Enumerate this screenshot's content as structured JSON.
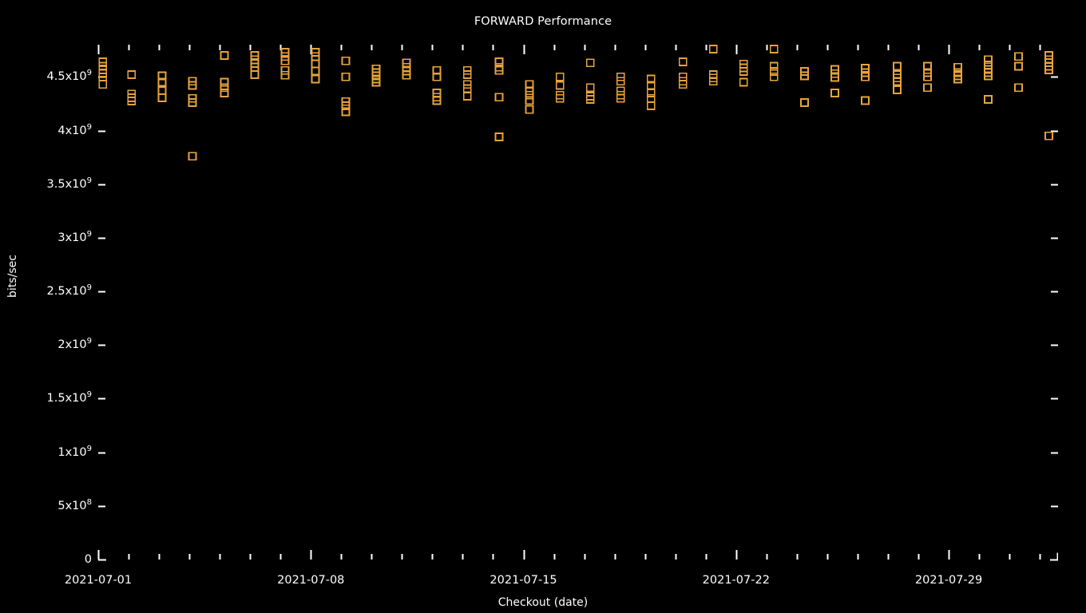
{
  "chart_data": {
    "type": "scatter",
    "title": "FORWARD Performance",
    "xlabel": "Checkout (date)",
    "ylabel": "bits/sec",
    "grid": false,
    "legend": null,
    "marker": "open-square",
    "marker_color": "#e8a33c",
    "background": "#000000",
    "foreground": "#ffffff",
    "ylim": [
      0,
      4800000000
    ],
    "ytick_labels": [
      {
        "text": "0",
        "sup": "",
        "value": 0
      },
      {
        "text": "5x10",
        "sup": "8",
        "value": 500000000
      },
      {
        "text": "1x10",
        "sup": "9",
        "value": 1000000000
      },
      {
        "text": "1.5x10",
        "sup": "9",
        "value": 1500000000
      },
      {
        "text": "2x10",
        "sup": "9",
        "value": 2000000000
      },
      {
        "text": "2.5x10",
        "sup": "9",
        "value": 2500000000
      },
      {
        "text": "3x10",
        "sup": "9",
        "value": 3000000000
      },
      {
        "text": "3.5x10",
        "sup": "9",
        "value": 3500000000
      },
      {
        "text": "4x10",
        "sup": "9",
        "value": 4000000000
      },
      {
        "text": "4.5x10",
        "sup": "9",
        "value": 4500000000
      }
    ],
    "xlim": [
      "2021-07-01",
      "2021-08-01"
    ],
    "xtick_labels": [
      {
        "text": "2021-07-01",
        "value": 0
      },
      {
        "text": "2021-07-08",
        "value": 7
      },
      {
        "text": "2021-07-15",
        "value": 14
      },
      {
        "text": "2021-07-22",
        "value": 21
      },
      {
        "text": "2021-07-29",
        "value": 28
      }
    ],
    "x_major_ticks": [
      0,
      7,
      14,
      21,
      28
    ],
    "x_minor_ticks": [
      1,
      2,
      3,
      4,
      5,
      6,
      8,
      9,
      10,
      11,
      12,
      13,
      15,
      16,
      17,
      18,
      19,
      20,
      22,
      23,
      24,
      25,
      26,
      27,
      29,
      30,
      31
    ],
    "series": [
      {
        "name": "FORWARD",
        "points": [
          {
            "x": 0.15,
            "y": 4640000000
          },
          {
            "x": 0.15,
            "y": 4600000000
          },
          {
            "x": 0.15,
            "y": 4565000000
          },
          {
            "x": 0.15,
            "y": 4535000000
          },
          {
            "x": 0.15,
            "y": 4500000000
          },
          {
            "x": 0.15,
            "y": 4430000000
          },
          {
            "x": 1.1,
            "y": 4520000000
          },
          {
            "x": 1.1,
            "y": 4340000000
          },
          {
            "x": 1.1,
            "y": 4305000000
          },
          {
            "x": 1.1,
            "y": 4275000000
          },
          {
            "x": 2.1,
            "y": 4510000000
          },
          {
            "x": 2.1,
            "y": 4450000000
          },
          {
            "x": 2.1,
            "y": 4370000000
          },
          {
            "x": 2.1,
            "y": 4305000000
          },
          {
            "x": 3.1,
            "y": 4460000000
          },
          {
            "x": 3.1,
            "y": 4420000000
          },
          {
            "x": 3.1,
            "y": 4300000000
          },
          {
            "x": 3.1,
            "y": 4260000000
          },
          {
            "x": 3.1,
            "y": 3760000000
          },
          {
            "x": 4.15,
            "y": 4700000000
          },
          {
            "x": 4.15,
            "y": 4450000000
          },
          {
            "x": 4.15,
            "y": 4400000000
          },
          {
            "x": 4.15,
            "y": 4350000000
          },
          {
            "x": 5.15,
            "y": 4700000000
          },
          {
            "x": 5.15,
            "y": 4660000000
          },
          {
            "x": 5.15,
            "y": 4625000000
          },
          {
            "x": 5.15,
            "y": 4590000000
          },
          {
            "x": 5.15,
            "y": 4520000000
          },
          {
            "x": 6.15,
            "y": 4730000000
          },
          {
            "x": 6.15,
            "y": 4690000000
          },
          {
            "x": 6.15,
            "y": 4650000000
          },
          {
            "x": 6.15,
            "y": 4560000000
          },
          {
            "x": 6.15,
            "y": 4515000000
          },
          {
            "x": 7.15,
            "y": 4730000000
          },
          {
            "x": 7.15,
            "y": 4690000000
          },
          {
            "x": 7.15,
            "y": 4620000000
          },
          {
            "x": 7.15,
            "y": 4555000000
          },
          {
            "x": 7.15,
            "y": 4480000000
          },
          {
            "x": 8.15,
            "y": 4650000000
          },
          {
            "x": 8.15,
            "y": 4500000000
          },
          {
            "x": 8.15,
            "y": 4270000000
          },
          {
            "x": 8.15,
            "y": 4230000000
          },
          {
            "x": 8.15,
            "y": 4175000000
          },
          {
            "x": 9.15,
            "y": 4575000000
          },
          {
            "x": 9.15,
            "y": 4540000000
          },
          {
            "x": 9.15,
            "y": 4510000000
          },
          {
            "x": 9.15,
            "y": 4480000000
          },
          {
            "x": 9.15,
            "y": 4450000000
          },
          {
            "x": 10.15,
            "y": 4630000000
          },
          {
            "x": 10.15,
            "y": 4590000000
          },
          {
            "x": 10.15,
            "y": 4555000000
          },
          {
            "x": 10.15,
            "y": 4515000000
          },
          {
            "x": 11.15,
            "y": 4560000000
          },
          {
            "x": 11.15,
            "y": 4500000000
          },
          {
            "x": 11.15,
            "y": 4350000000
          },
          {
            "x": 11.15,
            "y": 4310000000
          },
          {
            "x": 11.15,
            "y": 4280000000
          },
          {
            "x": 12.15,
            "y": 4560000000
          },
          {
            "x": 12.15,
            "y": 4520000000
          },
          {
            "x": 12.15,
            "y": 4430000000
          },
          {
            "x": 12.15,
            "y": 4390000000
          },
          {
            "x": 12.15,
            "y": 4320000000
          },
          {
            "x": 13.2,
            "y": 4640000000
          },
          {
            "x": 13.2,
            "y": 4590000000
          },
          {
            "x": 13.2,
            "y": 4560000000
          },
          {
            "x": 13.2,
            "y": 4310000000
          },
          {
            "x": 13.2,
            "y": 3940000000
          },
          {
            "x": 14.2,
            "y": 4430000000
          },
          {
            "x": 14.2,
            "y": 4370000000
          },
          {
            "x": 14.2,
            "y": 4330000000
          },
          {
            "x": 14.2,
            "y": 4280000000
          },
          {
            "x": 14.2,
            "y": 4195000000
          },
          {
            "x": 15.2,
            "y": 4500000000
          },
          {
            "x": 15.2,
            "y": 4420000000
          },
          {
            "x": 15.2,
            "y": 4330000000
          },
          {
            "x": 15.2,
            "y": 4300000000
          },
          {
            "x": 16.2,
            "y": 4630000000
          },
          {
            "x": 16.2,
            "y": 4400000000
          },
          {
            "x": 16.2,
            "y": 4320000000
          },
          {
            "x": 16.2,
            "y": 4290000000
          },
          {
            "x": 17.2,
            "y": 4500000000
          },
          {
            "x": 17.2,
            "y": 4460000000
          },
          {
            "x": 17.2,
            "y": 4370000000
          },
          {
            "x": 17.2,
            "y": 4330000000
          },
          {
            "x": 17.2,
            "y": 4300000000
          },
          {
            "x": 18.2,
            "y": 4480000000
          },
          {
            "x": 18.2,
            "y": 4420000000
          },
          {
            "x": 18.2,
            "y": 4350000000
          },
          {
            "x": 18.2,
            "y": 4300000000
          },
          {
            "x": 18.2,
            "y": 4230000000
          },
          {
            "x": 19.25,
            "y": 4640000000
          },
          {
            "x": 19.25,
            "y": 4500000000
          },
          {
            "x": 19.25,
            "y": 4460000000
          },
          {
            "x": 19.25,
            "y": 4430000000
          },
          {
            "x": 20.25,
            "y": 4760000000
          },
          {
            "x": 20.25,
            "y": 4520000000
          },
          {
            "x": 20.25,
            "y": 4490000000
          },
          {
            "x": 20.25,
            "y": 4460000000
          },
          {
            "x": 21.25,
            "y": 4620000000
          },
          {
            "x": 21.25,
            "y": 4585000000
          },
          {
            "x": 21.25,
            "y": 4550000000
          },
          {
            "x": 21.25,
            "y": 4450000000
          },
          {
            "x": 22.25,
            "y": 4760000000
          },
          {
            "x": 22.25,
            "y": 4600000000
          },
          {
            "x": 22.25,
            "y": 4550000000
          },
          {
            "x": 22.25,
            "y": 4500000000
          },
          {
            "x": 23.25,
            "y": 4550000000
          },
          {
            "x": 23.25,
            "y": 4510000000
          },
          {
            "x": 23.25,
            "y": 4260000000
          },
          {
            "x": 24.25,
            "y": 4570000000
          },
          {
            "x": 24.25,
            "y": 4530000000
          },
          {
            "x": 24.25,
            "y": 4495000000
          },
          {
            "x": 24.25,
            "y": 4350000000
          },
          {
            "x": 25.25,
            "y": 4580000000
          },
          {
            "x": 25.25,
            "y": 4540000000
          },
          {
            "x": 25.25,
            "y": 4500000000
          },
          {
            "x": 25.25,
            "y": 4280000000
          },
          {
            "x": 26.3,
            "y": 4600000000
          },
          {
            "x": 26.3,
            "y": 4520000000
          },
          {
            "x": 26.3,
            "y": 4490000000
          },
          {
            "x": 26.3,
            "y": 4460000000
          },
          {
            "x": 26.3,
            "y": 4380000000
          },
          {
            "x": 27.3,
            "y": 4600000000
          },
          {
            "x": 27.3,
            "y": 4540000000
          },
          {
            "x": 27.3,
            "y": 4500000000
          },
          {
            "x": 27.3,
            "y": 4400000000
          },
          {
            "x": 28.3,
            "y": 4590000000
          },
          {
            "x": 28.3,
            "y": 4540000000
          },
          {
            "x": 28.3,
            "y": 4510000000
          },
          {
            "x": 28.3,
            "y": 4480000000
          },
          {
            "x": 29.3,
            "y": 4660000000
          },
          {
            "x": 29.3,
            "y": 4610000000
          },
          {
            "x": 29.3,
            "y": 4570000000
          },
          {
            "x": 29.3,
            "y": 4540000000
          },
          {
            "x": 29.3,
            "y": 4510000000
          },
          {
            "x": 29.3,
            "y": 4290000000
          },
          {
            "x": 30.3,
            "y": 4690000000
          },
          {
            "x": 30.3,
            "y": 4600000000
          },
          {
            "x": 30.3,
            "y": 4400000000
          },
          {
            "x": 31.3,
            "y": 4700000000
          },
          {
            "x": 31.3,
            "y": 4660000000
          },
          {
            "x": 31.3,
            "y": 4600000000
          },
          {
            "x": 31.3,
            "y": 4565000000
          },
          {
            "x": 31.3,
            "y": 3950000000
          }
        ]
      }
    ]
  }
}
